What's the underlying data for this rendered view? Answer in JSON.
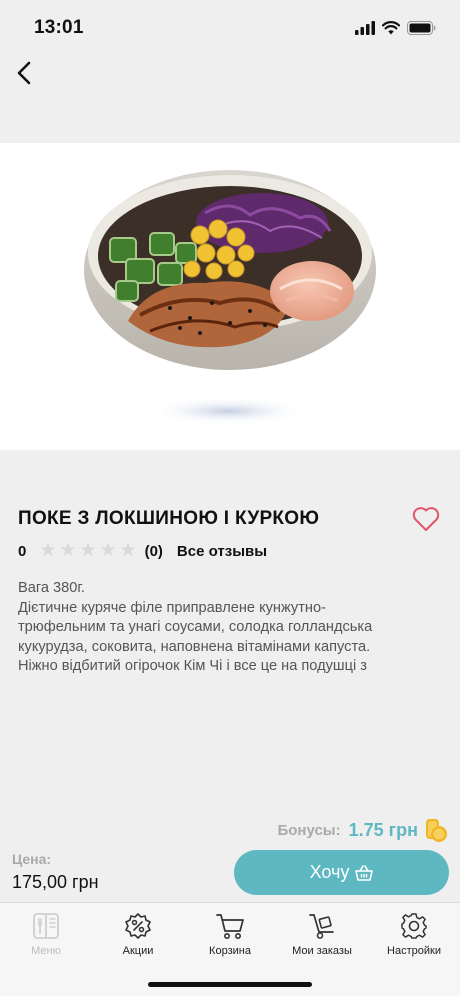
{
  "status_bar": {
    "time": "13:01"
  },
  "product": {
    "title": "ПОКЕ З ЛОКШИНОЮ І КУРКОЮ",
    "rating": "0",
    "rating_stars": 0,
    "rating_count": "(0)",
    "reviews_link": "Все отзывы",
    "description": "Вага 380г.\nДієтичне куряче філе приправлене кунжутно-\nтрюфельним та унагі соусами, солодка голландська\nкукурудза, соковита, наповнена вітамінами капуста.\nНіжно відбитий огірочок Кім Чі і все це на подушці з"
  },
  "bonus": {
    "label": "Бонусы:",
    "value": "1.75 грн"
  },
  "price": {
    "label": "Цена:",
    "value": "175,00 грн"
  },
  "want_button": {
    "label": "Хочу"
  },
  "tabs": [
    {
      "label": "Меню",
      "icon": "menu-book-icon",
      "active": true
    },
    {
      "label": "Акции",
      "icon": "percent-badge-icon",
      "active": false
    },
    {
      "label": "Корзина",
      "icon": "cart-icon",
      "active": false
    },
    {
      "label": "Мои заказы",
      "icon": "hand-truck-icon",
      "active": false
    },
    {
      "label": "Настройки",
      "icon": "gear-icon",
      "active": false
    }
  ],
  "colors": {
    "accent": "#5eb8c2",
    "heart": "#e0566a",
    "coin": "#f2b523"
  }
}
